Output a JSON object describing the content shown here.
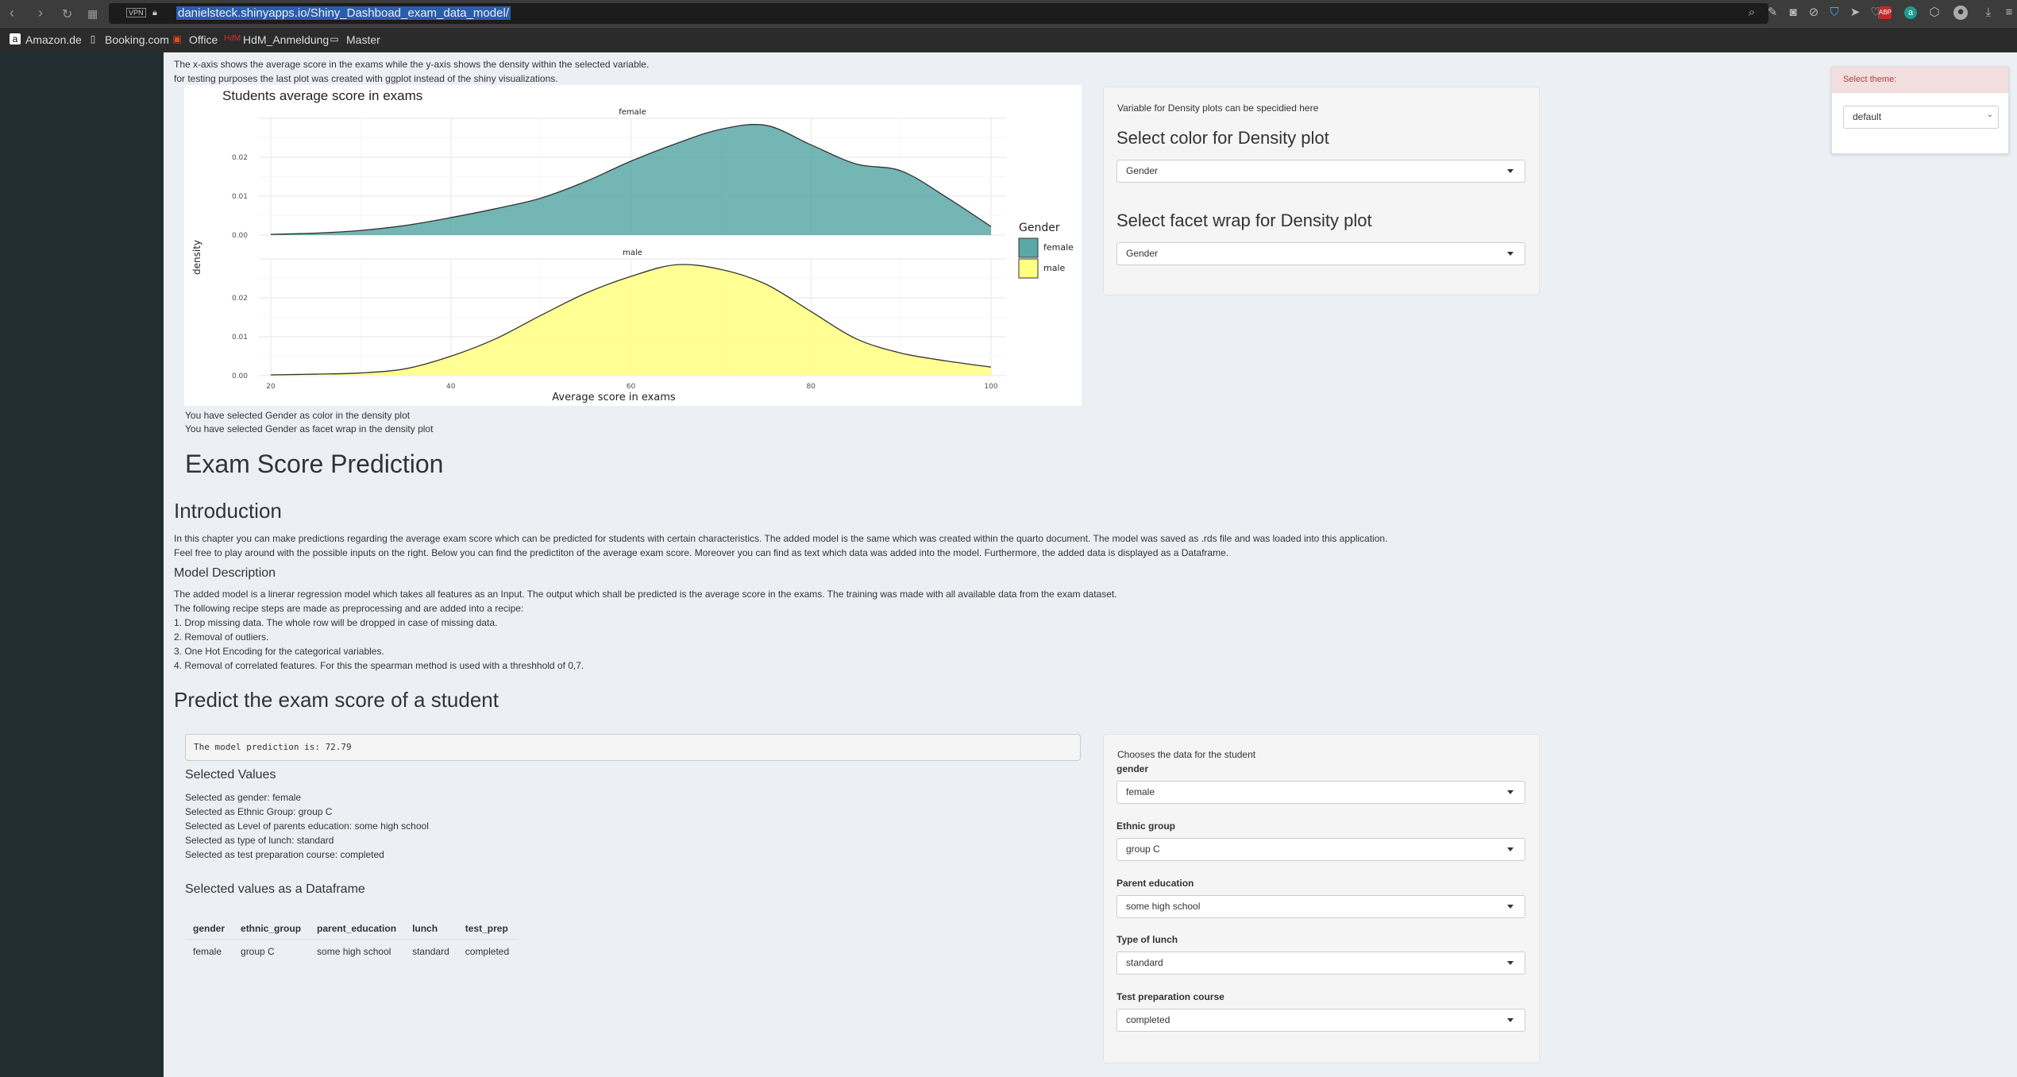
{
  "browser": {
    "url": "danielsteck.shinyapps.io/Shiny_Dashboad_exam_data_model/",
    "vpn_label": "VPN",
    "bookmarks": [
      {
        "label": "Amazon.de",
        "icon": "amazon-icon"
      },
      {
        "label": "Booking.com",
        "icon": "page-icon"
      },
      {
        "label": "Office",
        "icon": "office-icon"
      },
      {
        "label": "HdM_Anmeldung",
        "icon": "hdm-icon"
      },
      {
        "label": "Master",
        "icon": "folder-icon"
      }
    ]
  },
  "density_section": {
    "intro_line1": "The x-axis shows the average score in the exams while the y-axis shows the density within the selected variable.",
    "intro_line2": "for testing purposes the last plot was created with ggplot instead of the shiny visualizations.",
    "selected_color_text": "You have selected Gender as color in the density plot",
    "selected_facet_text": "You have selected Gender as facet wrap in the density plot"
  },
  "density_controls": {
    "note": "Variable for Density plots can be specidied here",
    "color_heading": "Select color for Density plot",
    "color_value": "Gender",
    "facet_heading": "Select facet wrap for Density plot",
    "facet_value": "Gender"
  },
  "chart_data": {
    "type": "area",
    "title": "Students average score in exams",
    "xlabel": "Average score in exams",
    "ylabel": "density",
    "xlim": [
      20,
      100
    ],
    "ylim": [
      0,
      0.03
    ],
    "x_ticks": [
      "20",
      "40",
      "60",
      "80",
      "100"
    ],
    "y_ticks": [
      "0.00",
      "0.01",
      "0.02"
    ],
    "legend_title": "Gender",
    "legend_position": "right",
    "grid": true,
    "x": [
      20,
      25,
      30,
      35,
      40,
      45,
      50,
      55,
      60,
      65,
      70,
      75,
      80,
      85,
      90,
      95,
      100
    ],
    "series": [
      {
        "name": "female",
        "color": "#5aa9a6",
        "values": [
          0.0002,
          0.0005,
          0.0012,
          0.0025,
          0.0045,
          0.0068,
          0.0095,
          0.0138,
          0.019,
          0.0235,
          0.0272,
          0.0282,
          0.0232,
          0.0183,
          0.0165,
          0.0098,
          0.0022
        ]
      },
      {
        "name": "male",
        "color": "#ffff80",
        "values": [
          0.0002,
          0.0004,
          0.0007,
          0.0018,
          0.005,
          0.0095,
          0.0155,
          0.0212,
          0.0255,
          0.0285,
          0.0273,
          0.0235,
          0.0165,
          0.0095,
          0.0058,
          0.0038,
          0.0022
        ]
      }
    ]
  },
  "prediction_section": {
    "page_heading": "Exam Score Prediction",
    "intro_heading": "Introduction",
    "intro_line1": "In this chapter you can make predictions regarding the average exam score which can be predicted for students with certain characteristics. The added model is the same which was created within the quarto document. The model was saved as .rds file and was loaded into this application.",
    "intro_line2": "Feel free to play around with the possible inputs on the right. Below you can find the predictiton of the average exam score. Moreover you can find as text which data was added into the model. Furthermore, the added data is displayed as a Dataframe.",
    "model_heading": "Model Description",
    "model_lines": [
      "The added model is a linerar regression model which takes all features as an Input. The output which shall be predicted is the average score in the exams. The training was made with all available data from the exam dataset.",
      "The following recipe steps are made as preprocessing and are added into a recipe:",
      "1. Drop missing data. The whole row will be dropped in case of missing data.",
      "2. Removal of outliers.",
      "3. One Hot Encoding for the categorical variables.",
      "4. Removal of correlated features. For this the spearman method is used with a threshhold of 0,7."
    ],
    "predict_heading": "Predict the exam score of a student",
    "prediction_text": "The model prediction is: 72.79",
    "selected_values_heading": "Selected Values",
    "selected_values": [
      "Selected as gender: female",
      "Selected as Ethnic Group: group C",
      "Selected as Level of parents education: some high school",
      "Selected as type of lunch: standard",
      "Selected as test preparation course: completed"
    ],
    "dataframe_heading": "Selected values as a Dataframe",
    "table": {
      "headers": [
        "gender",
        "ethnic_group",
        "parent_education",
        "lunch",
        "test_prep"
      ],
      "rows": [
        [
          "female",
          "group C",
          "some high school",
          "standard",
          "completed"
        ]
      ]
    }
  },
  "student_inputs": {
    "note": "Chooses the data for the student",
    "gender_label": "gender",
    "gender_value": "female",
    "ethnic_label": "Ethnic group",
    "ethnic_value": "group C",
    "parent_label": "Parent education",
    "parent_value": "some high school",
    "lunch_label": "Type of lunch",
    "lunch_value": "standard",
    "test_label": "Test preparation course",
    "test_value": "completed"
  },
  "theme_selector": {
    "label": "Select theme:",
    "value": "default"
  }
}
